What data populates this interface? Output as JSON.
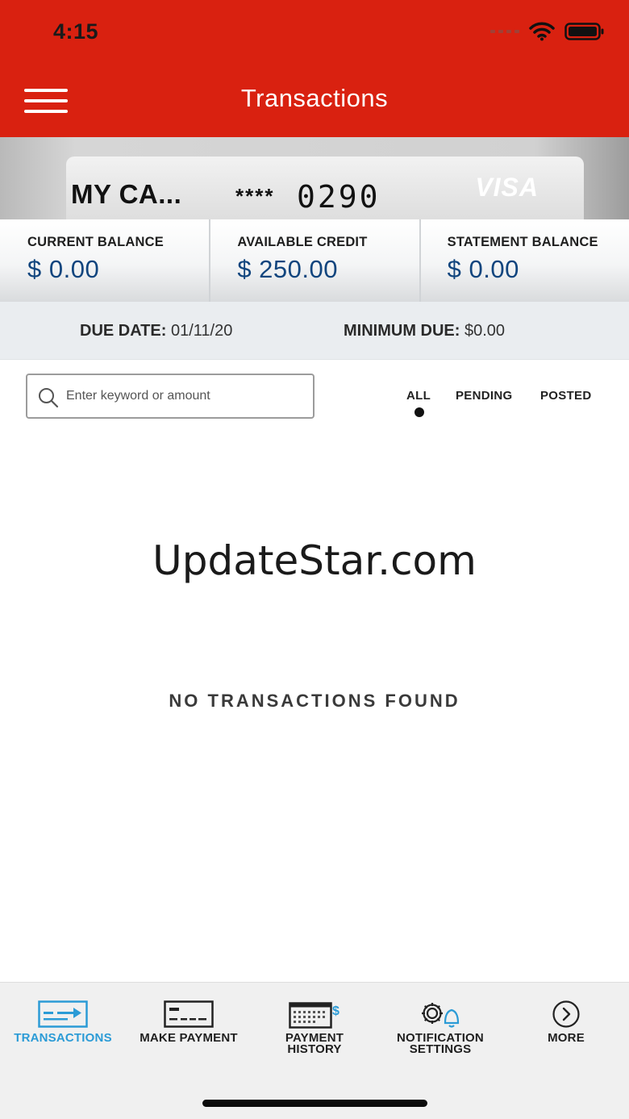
{
  "status_bar": {
    "time": "4:15"
  },
  "header": {
    "title": "Transactions"
  },
  "card": {
    "name": "MY CA...",
    "mask": "****",
    "last4": "0290",
    "brand": "VISA"
  },
  "balances": [
    {
      "label": "CURRENT BALANCE",
      "value": "$ 0.00"
    },
    {
      "label": "AVAILABLE CREDIT",
      "value": "$ 250.00"
    },
    {
      "label": "STATEMENT BALANCE",
      "value": "$ 0.00"
    }
  ],
  "due": {
    "date_label": "DUE DATE:",
    "date_value": "01/11/20",
    "min_label": "MINIMUM DUE:",
    "min_value": "$0.00"
  },
  "search": {
    "placeholder": "Enter keyword or amount",
    "value": ""
  },
  "filters": [
    {
      "label": "ALL",
      "selected": true
    },
    {
      "label": "PENDING",
      "selected": false
    },
    {
      "label": "POSTED",
      "selected": false
    }
  ],
  "watermark": "UpdateStar.com",
  "empty_message": "NO TRANSACTIONS FOUND",
  "tabs": [
    {
      "label_line1": "TRANSACTIONS",
      "label_line2": "",
      "icon": "transactions-icon",
      "active": true
    },
    {
      "label_line1": "MAKE PAYMENT",
      "label_line2": "",
      "icon": "make-payment-icon",
      "active": false
    },
    {
      "label_line1": "PAYMENT",
      "label_line2": "HISTORY",
      "icon": "payment-history-icon",
      "active": false
    },
    {
      "label_line1": "NOTIFICATION",
      "label_line2": "SETTINGS",
      "icon": "notification-settings-icon",
      "active": false
    },
    {
      "label_line1": "MORE",
      "label_line2": "",
      "icon": "more-icon",
      "active": false
    }
  ],
  "colors": {
    "header_red": "#d92110",
    "balance_blue": "#11457e",
    "active_tab_blue": "#2b9bd6"
  }
}
